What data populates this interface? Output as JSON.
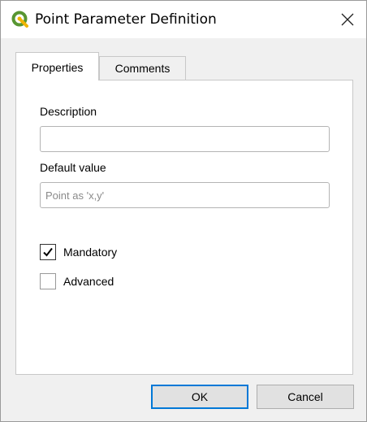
{
  "window": {
    "title": "Point Parameter Definition",
    "app_icon": "qgis-icon",
    "close_icon": "close-icon"
  },
  "tabs": [
    {
      "label": "Properties",
      "active": true
    },
    {
      "label": "Comments",
      "active": false
    }
  ],
  "form": {
    "description_label": "Description",
    "description_value": "",
    "default_value_label": "Default value",
    "default_value_value": "",
    "default_value_placeholder": "Point as 'x,y'"
  },
  "checkboxes": {
    "mandatory": {
      "label": "Mandatory",
      "checked": true
    },
    "advanced": {
      "label": "Advanced",
      "checked": false
    }
  },
  "buttons": {
    "ok": "OK",
    "cancel": "Cancel"
  },
  "colors": {
    "accent": "#0078d7",
    "qgis_green": "#589632",
    "qgis_yellow": "#f0b400"
  }
}
